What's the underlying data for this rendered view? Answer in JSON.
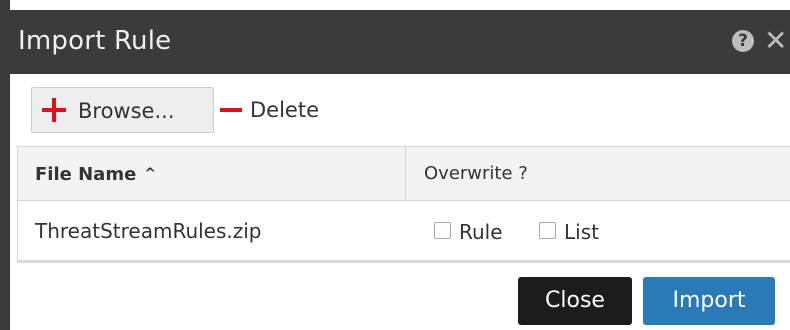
{
  "dialog": {
    "title": "Import Rule",
    "help_icon_glyph": "?",
    "close_icon_glyph": "✕"
  },
  "toolbar": {
    "browse_label": "Browse...",
    "browse_icon": "plus-icon",
    "delete_label": "Delete",
    "delete_icon": "minus-icon",
    "icon_color": "#e0101a"
  },
  "grid": {
    "columns": [
      {
        "label": "File Name",
        "sort": "ascending"
      },
      {
        "label": "Overwrite ?"
      }
    ],
    "sort_glyph": "^",
    "rows": [
      {
        "file_name": "ThreatStreamRules.zip",
        "overwrite": [
          {
            "label": "Rule",
            "checked": false
          },
          {
            "label": "List",
            "checked": false
          }
        ]
      }
    ]
  },
  "footer": {
    "close_label": "Close",
    "import_label": "Import",
    "import_color": "#2a7ab8",
    "close_color": "#1c1c1c"
  },
  "colors": {
    "titlebar": "#3b3b3b",
    "header_bg": "#f3f3f3"
  }
}
